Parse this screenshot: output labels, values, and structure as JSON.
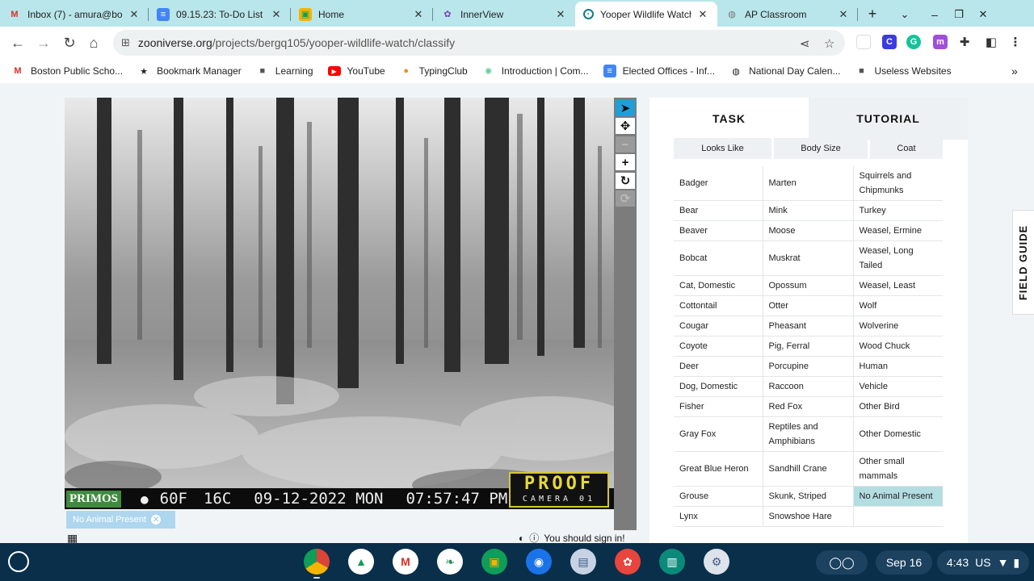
{
  "browser": {
    "tabs": [
      {
        "title": "Inbox (7) - amura@bo",
        "icon": "gmail-icon",
        "active": false
      },
      {
        "title": "09.15.23: To-Do List a",
        "icon": "docs-icon",
        "active": false
      },
      {
        "title": "Home",
        "icon": "classroom-icon",
        "active": false
      },
      {
        "title": "InnerView",
        "icon": "innerview-icon",
        "active": false
      },
      {
        "title": "Yooper Wildlife Watch",
        "icon": "zooniverse-icon",
        "active": true
      },
      {
        "title": "AP Classroom",
        "icon": "globe-icon",
        "active": false
      }
    ],
    "url_host": "zooniverse.org",
    "url_path": "/projects/bergq105/yooper-wildlife-watch/classify",
    "bookmarks": [
      {
        "label": "Boston Public Scho...",
        "icon": "gmail-icon"
      },
      {
        "label": "Bookmark Manager",
        "icon": "star-icon"
      },
      {
        "label": "Learning",
        "icon": "folder-icon"
      },
      {
        "label": "YouTube",
        "icon": "youtube-icon"
      },
      {
        "label": "TypingClub",
        "icon": "typingclub-icon"
      },
      {
        "label": "Introduction | Com...",
        "icon": "code-icon"
      },
      {
        "label": "Elected Offices - Inf...",
        "icon": "docs-icon"
      },
      {
        "label": "National Day Calen...",
        "icon": "globe-icon"
      },
      {
        "label": "Useless Websites",
        "icon": "folder-icon"
      }
    ],
    "more_label": "»"
  },
  "camera": {
    "brand": "PRIMOS",
    "temp_f": "60F",
    "temp_c": "16C",
    "date": "09-12-2022 MON",
    "time": "07:57:47 PM",
    "logo_top": "PROOF",
    "logo_bottom": "CAMERA 01"
  },
  "subject_tag": "No Animal Present",
  "signin_notice": "You should sign in!",
  "panel": {
    "tabs": [
      "TASK",
      "TUTORIAL"
    ],
    "filters": [
      "Looks Like",
      "Body Size",
      "Coat"
    ],
    "rows": [
      [
        "Badger",
        "Marten",
        "Squirrels and Chipmunks"
      ],
      [
        "Bear",
        "Mink",
        "Turkey"
      ],
      [
        "Beaver",
        "Moose",
        "Weasel, Ermine"
      ],
      [
        "Bobcat",
        "Muskrat",
        "Weasel, Long Tailed"
      ],
      [
        "Cat, Domestic",
        "Opossum",
        "Weasel, Least"
      ],
      [
        "Cottontail",
        "Otter",
        "Wolf"
      ],
      [
        "Cougar",
        "Pheasant",
        "Wolverine"
      ],
      [
        "Coyote",
        "Pig, Ferral",
        "Wood Chuck"
      ],
      [
        "Deer",
        "Porcupine",
        "Human"
      ],
      [
        "Dog, Domestic",
        "Raccoon",
        "Vehicle"
      ],
      [
        "Fisher",
        "Red Fox",
        "Other Bird"
      ],
      [
        "Gray Fox",
        "Reptiles and Amphibians",
        "Other Domestic"
      ],
      [
        "Great Blue Heron",
        "Sandhill Crane",
        "Other small mammals"
      ],
      [
        "Grouse",
        "Skunk, Striped",
        "No Animal Present"
      ],
      [
        "Lynx",
        "Snowshoe Hare",
        ""
      ]
    ],
    "selected": "No Animal Present"
  },
  "field_guide": "FIELD GUIDE",
  "shelf": {
    "date": "Sep 16",
    "time": "4:43",
    "locale": "US",
    "apps": [
      "chrome-icon",
      "drive-icon",
      "gmail-icon",
      "vine-icon",
      "classroom-icon",
      "camera-icon",
      "printer-icon",
      "palette-icon",
      "reader-icon",
      "settings-icon"
    ]
  },
  "colors": {
    "tabstrip": "#b9e6ea",
    "selected_answer": "#b4dde2",
    "shelf": "#092f4b",
    "active_tool": "#1f9fd9"
  }
}
